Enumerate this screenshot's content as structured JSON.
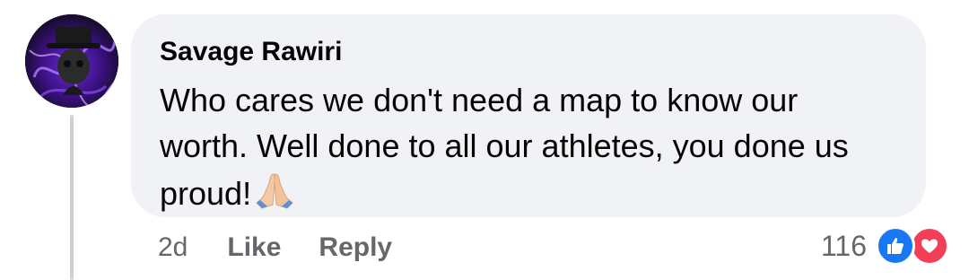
{
  "comment": {
    "author": "Savage Rawiri",
    "text": "Who cares we don't need a map to know our worth. Well done to all our athletes, you done us proud!",
    "emoji_icon": "folded-hands-icon"
  },
  "actions": {
    "time": "2d",
    "like_label": "Like",
    "reply_label": "Reply"
  },
  "reactions": {
    "count": "116",
    "types": [
      "like",
      "love"
    ],
    "like_color": "#1877f2",
    "love_color": "#f33e58"
  },
  "colors": {
    "bubble": "#f0f2f5",
    "secondary_text": "#65676b",
    "primary_text": "#050505"
  }
}
